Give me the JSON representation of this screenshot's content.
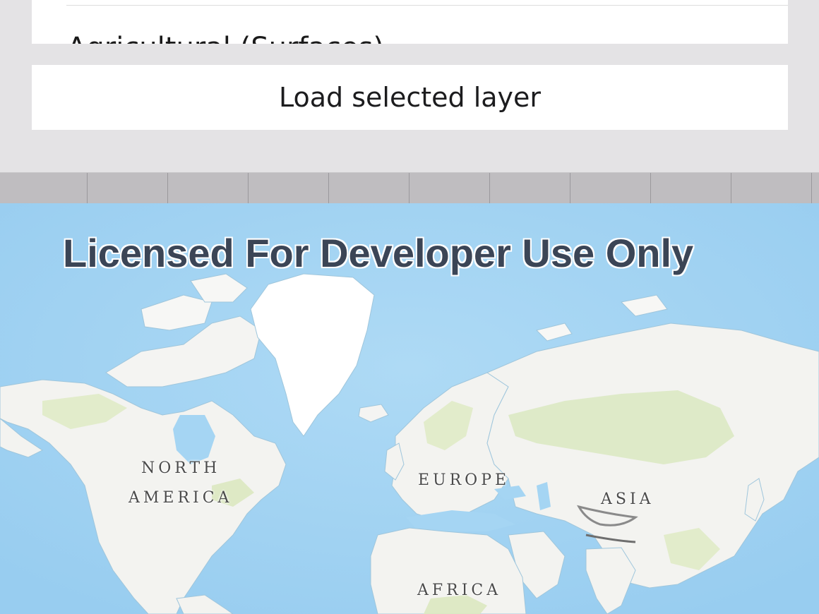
{
  "layer_list": {
    "partial_item_label": "Agricultural (Surfaces)"
  },
  "load_button": {
    "label": "Load selected layer"
  },
  "map": {
    "watermark": "Licensed For Developer Use Only",
    "labels": {
      "north_america_line1": "NORTH",
      "north_america_line2": "AMERICA",
      "europe": "EUROPE",
      "asia": "ASIA",
      "africa": "AFRICA"
    },
    "colors": {
      "ocean": "#a5d5f3",
      "land": "#f4f4f2",
      "vegetation": "#dfe9c4",
      "ice": "#ffffff"
    }
  }
}
